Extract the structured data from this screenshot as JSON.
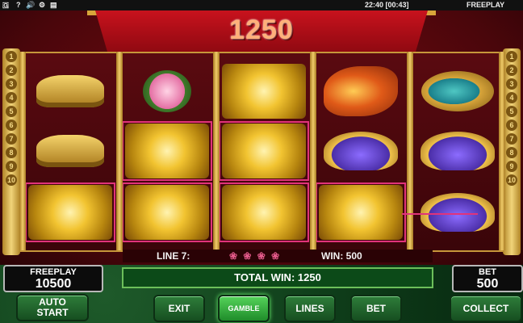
{
  "topbar": {
    "clock": "22:40 [00:43]",
    "mode": "FREEPLAY",
    "icons": [
      "flag-uk-icon",
      "help-icon",
      "sound-icon",
      "settings-icon",
      "folder-icon"
    ]
  },
  "game": {
    "win_display": "1250",
    "side_numbers": [
      "1",
      "2",
      "3",
      "4",
      "5",
      "6",
      "7",
      "8",
      "9",
      "10"
    ],
    "reels": [
      [
        "gold-ingot",
        "gold-ingot",
        "gold-peony"
      ],
      [
        "peony",
        "gold-peony",
        "gold-peony"
      ],
      [
        "gold-peony",
        "gold-peony",
        "gold-peony"
      ],
      [
        "phoenix",
        "turtle",
        "gold-peony"
      ],
      [
        "koi",
        "turtle",
        "turtle"
      ]
    ],
    "winning_cells": [
      [
        0,
        2
      ],
      [
        1,
        1
      ],
      [
        1,
        2
      ],
      [
        2,
        1
      ],
      [
        2,
        2
      ],
      [
        3,
        2
      ]
    ]
  },
  "info": {
    "line": "LINE 7:",
    "dots": "❀ ❀ ❀ ❀",
    "win": "WIN: 500"
  },
  "panels": {
    "freeplay_label": "FREEPLAY",
    "freeplay_value": "10500",
    "total_win": "TOTAL WIN: 1250",
    "bet_label": "BET",
    "bet_value": "500"
  },
  "buttons": {
    "auto_start_line1": "AUTO",
    "auto_start_line2": "START",
    "exit": "EXIT",
    "gamble": "GAMBLE",
    "lines": "LINES",
    "bet": "BET",
    "collect": "COLLECT"
  },
  "colors": {
    "win_highlight": "#e0337a",
    "accent_gold": "#d8a53a",
    "button_green": "#2e7d3a"
  }
}
